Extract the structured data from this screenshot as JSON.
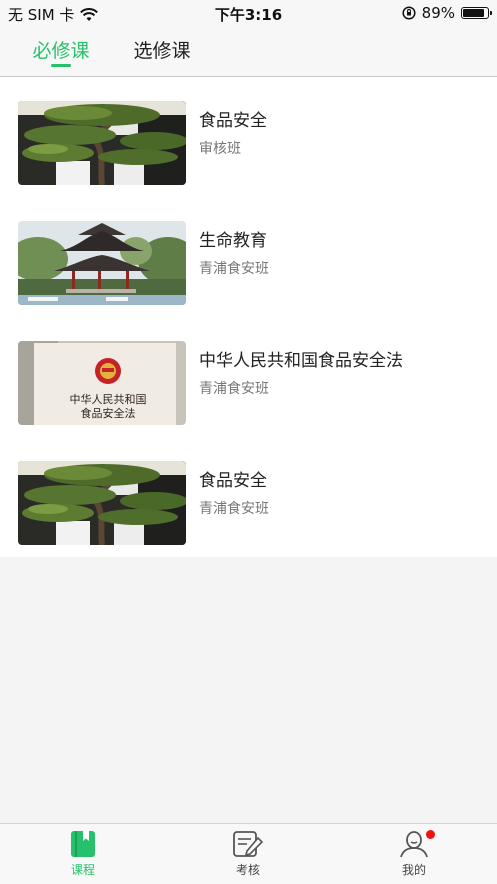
{
  "status_bar": {
    "carrier": "无 SIM 卡",
    "time": "下午3:16",
    "battery_text": "89%",
    "battery_level": 0.89
  },
  "tabs": [
    {
      "label": "必修课",
      "active": true
    },
    {
      "label": "选修课",
      "active": false
    }
  ],
  "courses": [
    {
      "title": "食品安全",
      "class": "审核班",
      "thumbnail": "bonsai-pine"
    },
    {
      "title": "生命教育",
      "class": "青浦食安班",
      "thumbnail": "pavilion"
    },
    {
      "title": "中华人民共和国食品安全法",
      "class": "青浦食安班",
      "thumbnail": "law-book",
      "thumbnail_text": [
        "中华人民共和国",
        "食品安全法"
      ]
    },
    {
      "title": "食品安全",
      "class": "青浦食安班",
      "thumbnail": "bonsai-pine"
    }
  ],
  "bottom_nav": [
    {
      "label": "课程",
      "icon": "book-icon",
      "active": true
    },
    {
      "label": "考核",
      "icon": "exam-icon",
      "active": false
    },
    {
      "label": "我的",
      "icon": "user-icon",
      "active": false,
      "badge": true
    }
  ],
  "colors": {
    "accent": "#27c06b",
    "badge": "#ee1111"
  }
}
